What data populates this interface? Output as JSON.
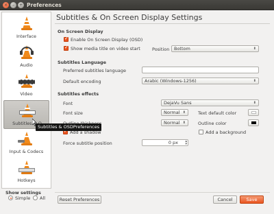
{
  "window": {
    "title": "Preferences"
  },
  "sidebar": {
    "items": [
      {
        "label": "Interface"
      },
      {
        "label": "Audio"
      },
      {
        "label": "Video"
      },
      {
        "label": "Subtitles & O"
      },
      {
        "label": "Input & Codecs"
      },
      {
        "label": "Hotkeys"
      }
    ],
    "selected_index": 3
  },
  "show_settings": {
    "label": "Show settings",
    "options": [
      "Simple",
      "All"
    ],
    "selected": "Simple"
  },
  "tooltip": {
    "text": "Subtitles & OSDPreferences"
  },
  "main": {
    "heading": "Subtitles & On Screen Display Settings",
    "osd": {
      "title": "On Screen Display",
      "enable_osd": {
        "label": "Enable On Screen Display (OSD)",
        "checked": true
      },
      "show_title": {
        "label": "Show media title on video start",
        "checked": true
      },
      "position_label": "Position",
      "position_value": "Bottom"
    },
    "language": {
      "title": "Subtitles Language",
      "preferred_label": "Preferred subtitles language",
      "preferred_value": "",
      "encoding_label": "Default encoding",
      "encoding_value": "Arabic (Windows-1256)"
    },
    "effects": {
      "title": "Subtitles effects",
      "font_label": "Font",
      "font_value": "DejaVu Sans",
      "font_size_label": "Font size",
      "font_size_value": "Normal",
      "text_color_label": "Text default color",
      "text_color": "#ffffff",
      "outline_thickness_label": "Outline thickness",
      "outline_thickness_value": "Normal",
      "outline_color_label": "Outline color",
      "outline_color": "#000000",
      "add_shadow": {
        "label": "Add a shadow",
        "checked": true
      },
      "add_background": {
        "label": "Add a background",
        "checked": false
      },
      "force_position_label": "Force subtitle position",
      "force_position_value": "0 px"
    }
  },
  "footer": {
    "reset_label": "Reset Preferences",
    "cancel_label": "Cancel",
    "save_label": "Save"
  },
  "colors": {
    "accent": "#e95420",
    "cone": "#f08a1c"
  }
}
